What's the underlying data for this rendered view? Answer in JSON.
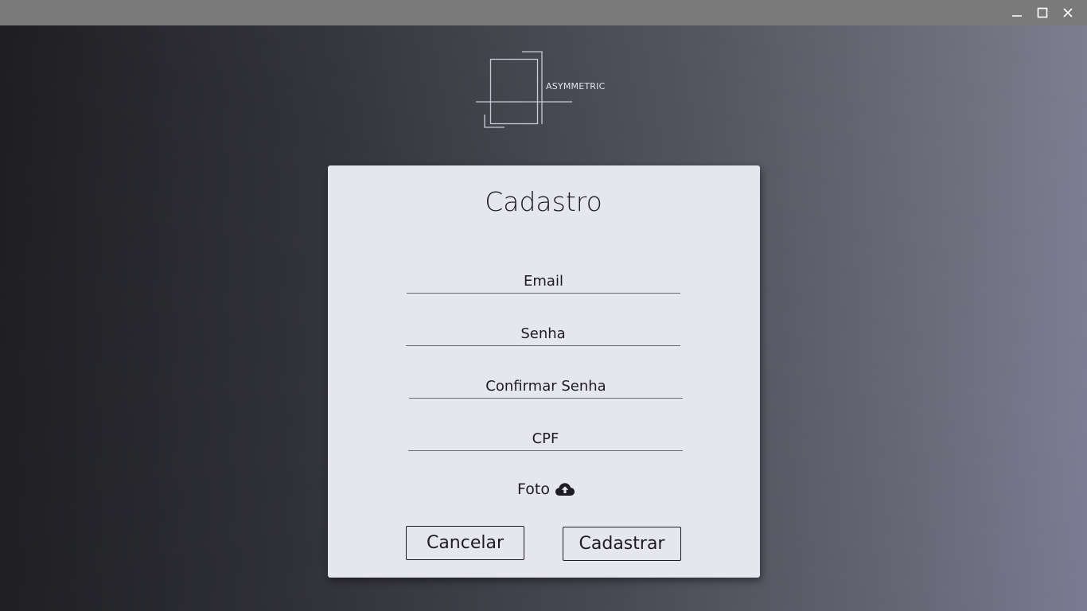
{
  "window": {
    "controls": [
      "minimize-icon",
      "maximize-icon",
      "close-icon"
    ]
  },
  "brand": {
    "name": "ASYMMETRIC"
  },
  "form": {
    "title": "Cadastro",
    "email_placeholder": "Email",
    "password_placeholder": "Senha",
    "confirm_password_placeholder": "Confirmar Senha",
    "cpf_placeholder": "CPF",
    "photo_label": "Foto",
    "photo_icon": "cloud-upload-icon",
    "cancel_label": "Cancelar",
    "submit_label": "Cadastrar"
  },
  "colors": {
    "card_background": "#e6e6ee",
    "text": "#1c1c22",
    "titlebar": "#7a7a7a"
  }
}
